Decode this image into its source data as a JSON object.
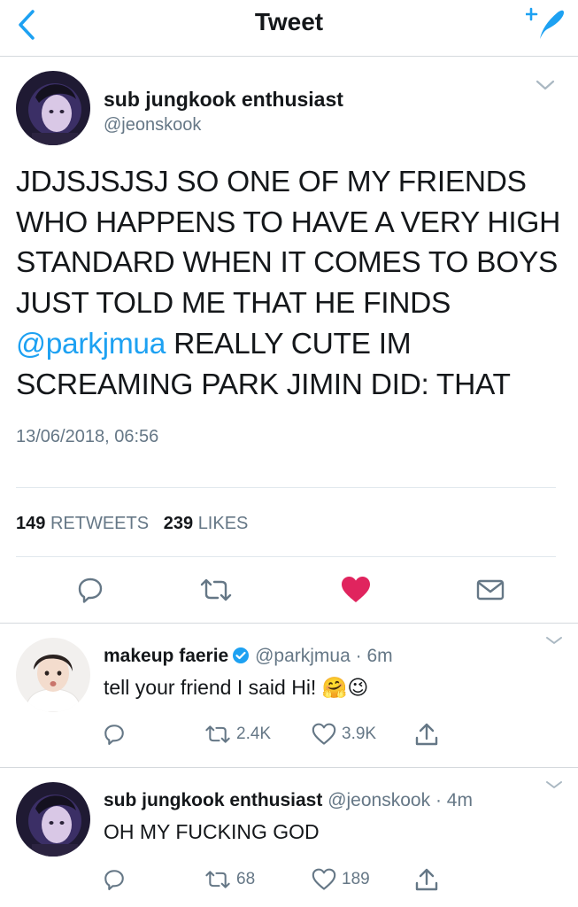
{
  "nav": {
    "title": "Tweet",
    "back_icon": "chevron-left-icon",
    "compose_icon": "compose-tweet-icon",
    "accent": "#1da1f2"
  },
  "main_tweet": {
    "name": "sub jungkook enthusiast",
    "handle": "@jeonskook",
    "text_before": "JDJSJSJSJ SO ONE OF MY FRIENDS WHO HAPPENS TO HAVE A VERY HIGH STANDARD WHEN IT COMES TO BOYS JUST TOLD ME THAT HE FINDS ",
    "mention": "@parkjmua",
    "text_after": " REALLY CUTE IM SCREAMING PARK JIMIN DID: THAT",
    "timestamp": "13/06/2018, 06:56",
    "retweets_count": "149",
    "retweets_label": "RETWEETS",
    "likes_count": "239",
    "likes_label": "LIKES",
    "like_color": "#e0245e"
  },
  "replies": [
    {
      "name": "makeup faerie",
      "handle": "@parkjmua",
      "time": "6m",
      "text": "tell your friend I said Hi!",
      "emojis": "🤗😉",
      "retweets": "2.4K",
      "likes": "3.9K"
    },
    {
      "name": "sub jungkook enthusiast",
      "handle": "@jeonskook",
      "time": "4m",
      "text": "OH MY FUCKING GOD",
      "emojis": "",
      "retweets": "68",
      "likes": "189"
    }
  ]
}
